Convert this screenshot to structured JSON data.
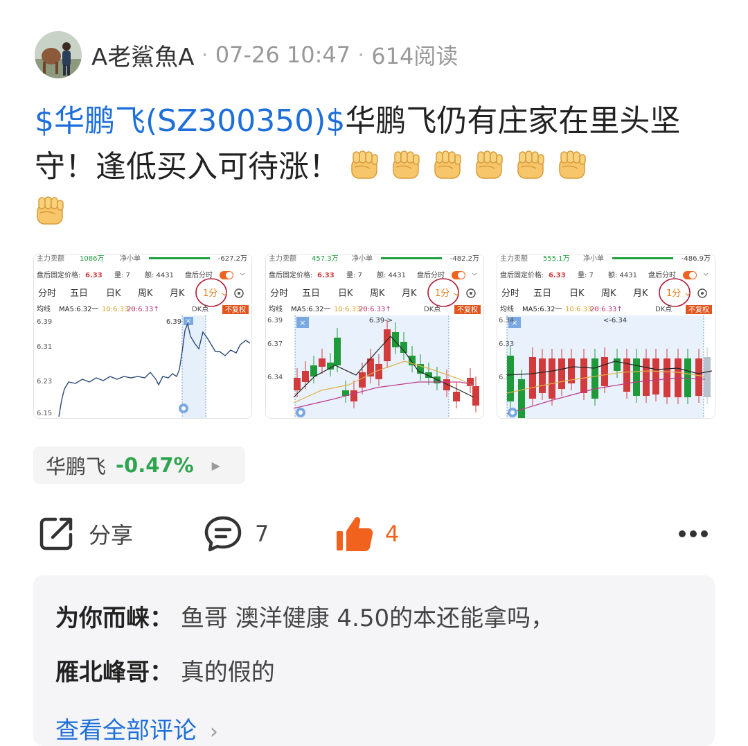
{
  "post": {
    "author": "A老鯊魚A",
    "time": "07-26 10:47",
    "reads": "614阅读",
    "stock_tag": "$华鹏飞(SZ300350)$",
    "text": "华鹏飞仍有庄家在里头坚守！逢低买入可待涨！"
  },
  "thumbnails": [
    {
      "r1a": "主力卖额",
      "r1b": "1086万",
      "r1c": "净小单",
      "r1d": "-627.2万",
      "price_label": "盘后固定价格:",
      "price": "6.33",
      "vol_label": "量: 7",
      "amt_label": "额: 4431",
      "toggle_label": "盘后分时",
      "tabs": [
        "分时",
        "五日",
        "日K",
        "周K",
        "月K",
        "1分"
      ],
      "ma_prefix": "均线",
      "ma5": "MA5:6.32一",
      "ma10": "10:6.33一",
      "ma20": "20:6.33↑",
      "dk": "DK点",
      "fq": "不复权",
      "axis": [
        "6.39",
        "6.31",
        "6.23",
        "6.15"
      ],
      "peak_label": "6.39"
    },
    {
      "r1a": "主力卖额",
      "r1b": "457.3万",
      "r1c": "净小单",
      "r1d": "-482.2万",
      "price_label": "盘后固定价格:",
      "price": "6.33",
      "vol_label": "量: 7",
      "amt_label": "额: 4431",
      "toggle_label": "盘后分时",
      "tabs": [
        "分时",
        "五日",
        "日K",
        "周K",
        "月K",
        "1分"
      ],
      "ma_prefix": "均线",
      "ma5": "MA5:6.32一",
      "ma10": "10:6.33一",
      "ma20": "20:6.33↑",
      "dk": "DK点",
      "fq": "不复权",
      "axis": [
        "6.39",
        "6.37",
        "6.34"
      ],
      "peak_label": "6.39->"
    },
    {
      "r1a": "主力卖额",
      "r1b": "555.1万",
      "r1c": "净小单",
      "r1d": "-486.9万",
      "price_label": "盘后固定价格:",
      "price": "6.33",
      "vol_label": "量: 7",
      "amt_label": "额: 4431",
      "toggle_label": "盘后分时",
      "tabs": [
        "分时",
        "五日",
        "日K",
        "周K",
        "月K",
        "1分"
      ],
      "ma_prefix": "均线",
      "ma5": "MA5:6.32一",
      "ma10": "10:6.33一",
      "ma20": "20:6.33↑",
      "dk": "DK点",
      "fq": "不复权",
      "axis": [
        "6.34",
        "6.33",
        "6.3"
      ],
      "peak_label": "<-6.34"
    }
  ],
  "stock_card": {
    "name": "华鹏飞",
    "change": "-0.47%"
  },
  "actions": {
    "share": "分享",
    "comments": "7",
    "likes": "4"
  },
  "comments": [
    {
      "user": "为你而崃",
      "text": "鱼哥 澳洋健康 4.50的本还能拿吗，"
    },
    {
      "user": "雁北峰哥",
      "text": "真的假的"
    }
  ],
  "view_all": "查看全部评论",
  "colors": {
    "link": "#1e6fd9",
    "green": "#2da44e",
    "like": "#f0621e",
    "up": "#d23b3b",
    "down": "#1f9a3a"
  }
}
